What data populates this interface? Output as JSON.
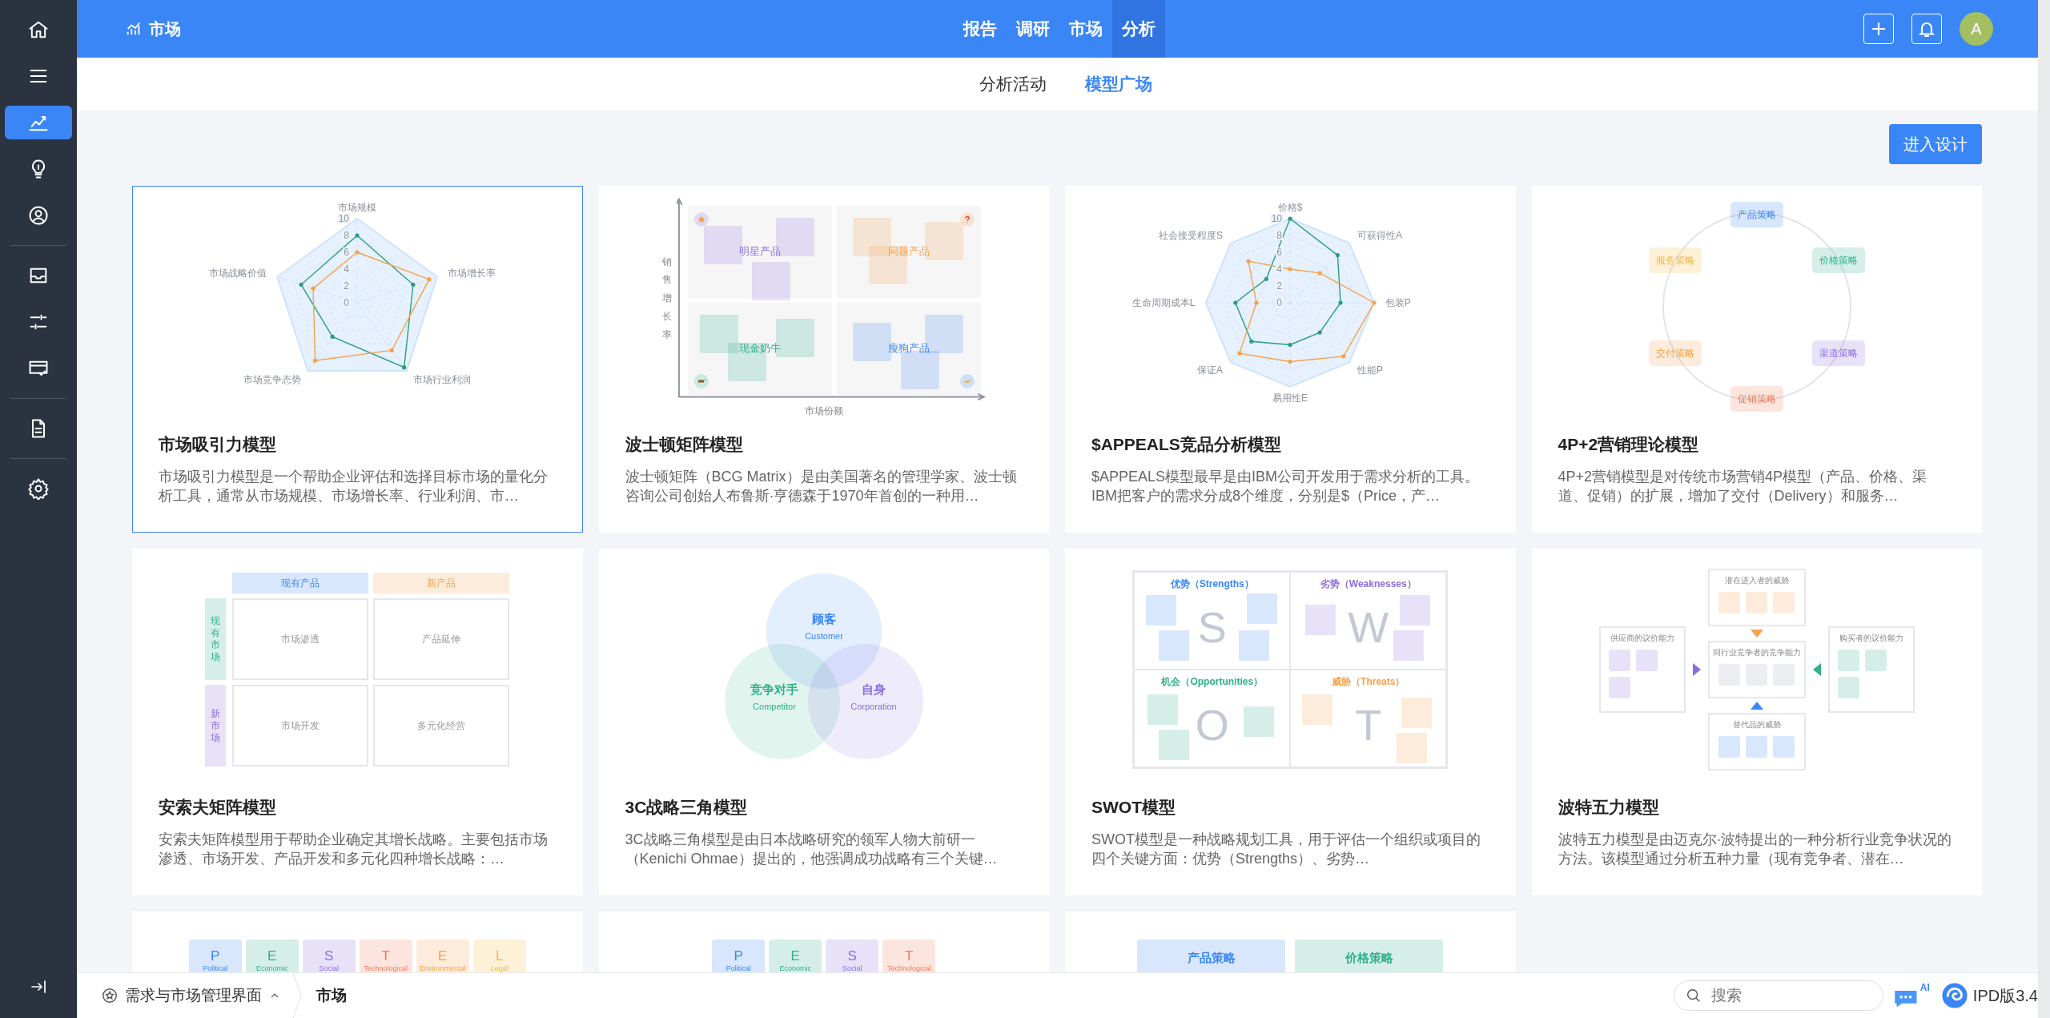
{
  "sidebar": {
    "groups": [
      [
        {
          "kind": "home",
          "selected": false
        },
        {
          "kind": "menu",
          "selected": false
        },
        {
          "kind": "chart",
          "selected": true
        },
        {
          "kind": "bulb",
          "selected": false
        },
        {
          "kind": "user",
          "selected": false
        }
      ],
      [
        {
          "kind": "inbox",
          "selected": false
        },
        {
          "kind": "sliders",
          "selected": false
        },
        {
          "kind": "card",
          "selected": false
        }
      ],
      [
        {
          "kind": "document",
          "selected": false
        }
      ],
      [
        {
          "kind": "settings",
          "selected": false
        }
      ]
    ]
  },
  "header": {
    "title": "市场",
    "nav": [
      {
        "label": "报告",
        "selected": false
      },
      {
        "label": "调研",
        "selected": false
      },
      {
        "label": "市场",
        "selected": false
      },
      {
        "label": "分析",
        "selected": true
      }
    ],
    "avatar": "A"
  },
  "subnav": [
    {
      "label": "分析活动",
      "selected": false
    },
    {
      "label": "模型广场",
      "selected": true
    }
  ],
  "design_button": "进入设计",
  "cards": [
    {
      "kind": "radar",
      "selected": true,
      "title": "市场吸引力模型",
      "description": "市场吸引力模型是一个帮助企业评估和选择目标市场的量化分析工具，通常从市场规模、市场增长率、行业利润、市…",
      "axes": [
        "市场规模",
        "市场增长率",
        "市场行业利润",
        "市场竞争态势",
        "市场战略价值"
      ],
      "ticks": [
        "10",
        "8",
        "6",
        "4",
        "2",
        "0"
      ]
    },
    {
      "kind": "bcg",
      "selected": false,
      "title": "波士顿矩阵模型",
      "description": "波士顿矩阵（BCG Matrix）是由美国著名的管理学家、波士顿咨询公司创始人布鲁斯·亨德森于1970年首创的一种用…",
      "y_label": "销售增长率",
      "x_label": "市场份额",
      "quadrants": [
        {
          "label": "明星产品",
          "color": "#8a6ee0"
        },
        {
          "label": "问题产品",
          "color": "#f5a04a"
        },
        {
          "label": "现金奶牛",
          "color": "#2fb08a"
        },
        {
          "label": "瘦狗产品",
          "color": "#3a86f7"
        }
      ]
    },
    {
      "kind": "radar",
      "selected": false,
      "title": "$APPEALS竞品分析模型",
      "description": "$APPEALS模型最早是由IBM公司开发用于需求分析的工具。IBM把客户的需求分成8个维度，分别是$（Price，产…",
      "axes": [
        "价格$",
        "可获得性A",
        "包装P",
        "性能P",
        "易用性E",
        "保证A",
        "生命周期成本L",
        "社会接受程度S"
      ],
      "ticks": [
        "10",
        "8",
        "6",
        "4",
        "2",
        "0"
      ]
    },
    {
      "kind": "cycle",
      "selected": false,
      "title": "4P+2营销理论模型",
      "description": "4P+2营销模型是对传统市场营销4P模型（产品、价格、渠道、促销）的扩展，增加了交付（Delivery）和服务…",
      "nodes": [
        {
          "label": "产品策略",
          "color": "#3a86f7"
        },
        {
          "label": "服务策略",
          "color": "#f5b83d"
        },
        {
          "label": "价格策略",
          "color": "#2fb08a"
        },
        {
          "label": "交付策略",
          "color": "#f5a04a"
        },
        {
          "label": "渠道策略",
          "color": "#8a6ee0"
        },
        {
          "label": "促销策略",
          "color": "#f27c5c"
        }
      ]
    },
    {
      "kind": "ansoff",
      "selected": false,
      "title": "安索夫矩阵模型",
      "description": "安索夫矩阵模型用于帮助企业确定其增长战略。主要包括市场渗透、市场开发、产品开发和多元化四种增长战略：…",
      "columns": [
        {
          "label": "现有产品",
          "color": "#3a86f7"
        },
        {
          "label": "新产品",
          "color": "#f5a04a"
        }
      ],
      "rows": [
        {
          "label": "现有市场",
          "color": "#2fb08a"
        },
        {
          "label": "新市场",
          "color": "#8a6ee0"
        }
      ],
      "cells": [
        "市场渗透",
        "产品延伸",
        "市场开发",
        "多元化经营"
      ]
    },
    {
      "kind": "venn",
      "selected": false,
      "title": "3C战略三角模型",
      "description": "3C战略三角模型是由日本战略研究的领军人物大前研一（Kenichi Ohmae）提出的，他强调成功战略有三个关键…",
      "circles": [
        {
          "name": "顾客",
          "english": "Customer",
          "color": "#3a86f7"
        },
        {
          "name": "竞争对手",
          "english": "Competitor",
          "color": "#2fb08a"
        },
        {
          "name": "自身",
          "english": "Corporation",
          "color": "#8a6ee0"
        }
      ]
    },
    {
      "kind": "swot",
      "selected": false,
      "title": "SWOT模型",
      "description": "SWOT模型是一种战略规划工具，用于评估一个组织或项目的四个关键方面：优势（Strengths）、劣势…",
      "quadrants": [
        {
          "label": "优势（Strengths）",
          "letter": "S",
          "color": "#3a86f7"
        },
        {
          "label": "劣势（Weaknesses）",
          "letter": "W",
          "color": "#8a6ee0"
        },
        {
          "label": "机会（Opportunities）",
          "letter": "O",
          "color": "#2fb08a"
        },
        {
          "label": "威胁（Threats）",
          "letter": "T",
          "color": "#f5a04a"
        }
      ]
    },
    {
      "kind": "porter",
      "selected": false,
      "title": "波特五力模型",
      "description": "波特五力模型是由迈克尔·波特提出的一种分析行业竞争状况的方法。该模型通过分析五种力量（现有竞争者、潜在…",
      "forces": [
        {
          "label": "潜在进入者的威胁",
          "color": "#f5a04a"
        },
        {
          "label": "供应商的议价能力",
          "color": "#8a6ee0"
        },
        {
          "label": "同行业竞争者的竞争能力",
          "color": "#eceef2"
        },
        {
          "label": "购买者的议价能力",
          "color": "#2fb08a"
        },
        {
          "label": "替代品的威胁",
          "color": "#3a86f7"
        }
      ]
    },
    {
      "kind": "pest",
      "selected": false,
      "factors": [
        {
          "letter": "P",
          "name": "Political",
          "color": "#3a86f7"
        },
        {
          "letter": "E",
          "name": "Economic",
          "color": "#2fb08a"
        },
        {
          "letter": "S",
          "name": "Social",
          "color": "#8a6ee0"
        },
        {
          "letter": "T",
          "name": "Technological",
          "color": "#f27c5c"
        },
        {
          "letter": "E",
          "name": "Environmental",
          "color": "#f5a04a"
        },
        {
          "letter": "L",
          "name": "Legal",
          "color": "#f5b83d"
        }
      ]
    },
    {
      "kind": "pest",
      "selected": false,
      "factors": [
        {
          "letter": "P",
          "name": "Political",
          "color": "#3a86f7"
        },
        {
          "letter": "E",
          "name": "Economic",
          "color": "#2fb08a"
        },
        {
          "letter": "S",
          "name": "Social",
          "color": "#8a6ee0"
        },
        {
          "letter": "T",
          "name": "Technological",
          "color": "#f27c5c"
        }
      ]
    },
    {
      "kind": "strategy",
      "selected": false,
      "boxes": [
        {
          "label": "产品策略",
          "color": "#3a86f7"
        },
        {
          "label": "价格策略",
          "color": "#2fb08a"
        }
      ]
    }
  ],
  "footer": {
    "breadcrumb": [
      "需求与市场管理界面",
      "市场"
    ],
    "search": {
      "placeholder": "搜索"
    },
    "ai_badge": "AI",
    "version": "IPD版3.4"
  }
}
